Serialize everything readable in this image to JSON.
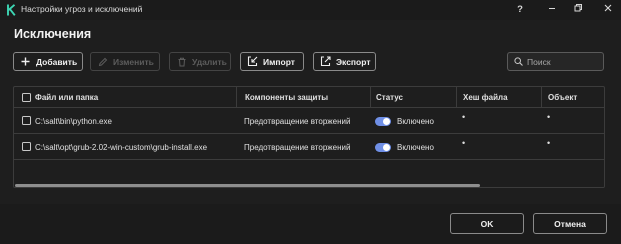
{
  "window": {
    "title": "Настройки угроз и исключений",
    "help_label": "?"
  },
  "page": {
    "title": "Исключения"
  },
  "toolbar": {
    "add_label": "Добавить",
    "edit_label": "Изменить",
    "delete_label": "Удалить",
    "import_label": "Импорт",
    "export_label": "Экспорт"
  },
  "search": {
    "placeholder": "Поиск",
    "value": ""
  },
  "table": {
    "headers": {
      "file": "Файл или папка",
      "components": "Компоненты защиты",
      "status": "Статус",
      "hash": "Хеш файла",
      "object": "Объект"
    },
    "rows": [
      {
        "file": "C:\\salt\\bin\\python.exe",
        "components": "Предотвращение вторжений",
        "status": "Включено",
        "status_enabled": true,
        "hash": "•",
        "object": "•"
      },
      {
        "file": "C:\\salt\\opt\\grub-2.02-win-custom\\grub-install.exe",
        "components": "Предотвращение вторжений",
        "status": "Включено",
        "status_enabled": true,
        "hash": "•",
        "object": "•"
      }
    ]
  },
  "footer": {
    "ok_label": "OK",
    "cancel_label": "Отмена"
  },
  "colors": {
    "background": "#1e1e1e",
    "toggle_on": "#6f8fe6",
    "brand_logo": "#3dd6b4"
  },
  "icons": {
    "logo": "kaspersky-k-logo",
    "help": "help-icon",
    "minimize": "minimize-icon",
    "maximize": "maximize-icon",
    "close": "close-icon",
    "add": "plus-icon",
    "edit": "pencil-icon",
    "delete": "trash-icon",
    "import": "import-icon",
    "export": "export-icon",
    "search": "search-icon"
  }
}
